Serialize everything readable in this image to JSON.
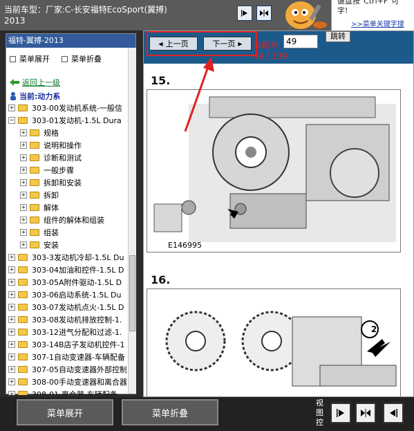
{
  "header": {
    "title": "当前车型：厂家:C-长安福特EcoSport(翼搏)\n2013",
    "tip_line1": "键盘按\"Ctrl+F\"可\n字!",
    "tip_link": ">>菜单关键字搜"
  },
  "sidebar": {
    "title": "福特-翼搏-2013",
    "expand_label": "菜单展开",
    "collapse_label": "菜单折叠",
    "back_label": "返回上一级",
    "current_label": "当前:动力系",
    "tree": [
      {
        "label": "303-00发动机系统-一般信",
        "expanded": false,
        "level": 0
      },
      {
        "label": "303-01发动机-1.5L Dura",
        "expanded": true,
        "level": 0
      },
      {
        "label": "规格",
        "expanded": false,
        "level": 1
      },
      {
        "label": "说明和操作",
        "expanded": false,
        "level": 1
      },
      {
        "label": "诊断和测试",
        "expanded": false,
        "level": 1
      },
      {
        "label": "一般步骤",
        "expanded": false,
        "level": 1
      },
      {
        "label": "拆卸和安装",
        "expanded": false,
        "level": 1
      },
      {
        "label": "拆卸",
        "expanded": false,
        "level": 1
      },
      {
        "label": "解体",
        "expanded": false,
        "level": 1
      },
      {
        "label": "组件的解体和组装",
        "expanded": false,
        "level": 1
      },
      {
        "label": "组装",
        "expanded": false,
        "level": 1
      },
      {
        "label": "安装",
        "expanded": false,
        "level": 1
      },
      {
        "label": "303-3发动机冷却-1.5L Du",
        "expanded": false,
        "level": 0
      },
      {
        "label": "303-04加油和控件-1.5L D",
        "expanded": false,
        "level": 0
      },
      {
        "label": "303-05A附件驱动-1.5L D",
        "expanded": false,
        "level": 0
      },
      {
        "label": "303-06启动系统-1.5L Du",
        "expanded": false,
        "level": 0
      },
      {
        "label": "303-07发动机点火-1.5L D",
        "expanded": false,
        "level": 0
      },
      {
        "label": "303-08发动机排放控制-1.",
        "expanded": false,
        "level": 0
      },
      {
        "label": "303-12进气分配和过滤-1.",
        "expanded": false,
        "level": 0
      },
      {
        "label": "303-14B店子发动机控件-1",
        "expanded": false,
        "level": 0
      },
      {
        "label": "307-1自动变速器-车辆配备",
        "expanded": false,
        "level": 0
      },
      {
        "label": "307-05自动变速器外部控制",
        "expanded": false,
        "level": 0
      },
      {
        "label": "308-00手动变速器和离合器",
        "expanded": false,
        "level": 0
      },
      {
        "label": "308-01-离合器-车辆配备",
        "expanded": false,
        "level": 0
      }
    ]
  },
  "content": {
    "prev_label": "上一页",
    "next_label": "下一页",
    "page_label": "当前为",
    "page_value": "49",
    "jump_label": "跳转",
    "page_count": "49 / 139",
    "step1": "15.",
    "figure_label": "E146995",
    "step2": "16.",
    "callout": "2"
  },
  "bottom": {
    "expand_label": "菜单展开",
    "collapse_label": "菜单折叠",
    "view_label": "视图控"
  }
}
